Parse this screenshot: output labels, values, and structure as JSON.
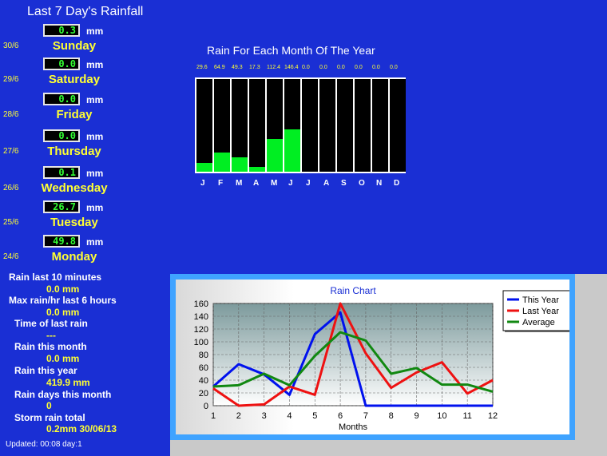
{
  "title": "Last 7 Day's Rainfall",
  "unit": "mm",
  "days": [
    {
      "date": "30/6",
      "name": "Sunday",
      "value": "0.3"
    },
    {
      "date": "29/6",
      "name": "Saturday",
      "value": "0.0"
    },
    {
      "date": "28/6",
      "name": "Friday",
      "value": "0.0"
    },
    {
      "date": "27/6",
      "name": "Thursday",
      "value": "0.0"
    },
    {
      "date": "26/6",
      "name": "Wednesday",
      "value": "0.1"
    },
    {
      "date": "25/6",
      "name": "Tuesday",
      "value": "26.7"
    },
    {
      "date": "24/6",
      "name": "Monday",
      "value": "49.8"
    }
  ],
  "stats": [
    {
      "label": "Rain last 10 minutes",
      "value": "0.0 mm"
    },
    {
      "label": "Max rain/hr last 6 hours",
      "value": "0.0 mm"
    },
    {
      "label": "Time of last rain",
      "value": "---"
    },
    {
      "label": "Rain this month",
      "value": "0.0 mm"
    },
    {
      "label": "Rain this year",
      "value": "419.9 mm"
    },
    {
      "label": "Rain days this month",
      "value": "0"
    },
    {
      "label": "Storm rain total",
      "value": "0.2mm 30/06/13"
    }
  ],
  "updated": "Updated: 00:08 day:1",
  "colors": {
    "background": "#1a2fd4",
    "highlight": "#ffff33",
    "bar": "#00ee22",
    "this_year": "#0011ee",
    "last_year": "#ee1111",
    "average": "#118811"
  },
  "chart_data": [
    {
      "type": "bar",
      "title": "Rain For Each Month Of The Year",
      "categories": [
        "J",
        "F",
        "M",
        "A",
        "M",
        "J",
        "J",
        "A",
        "S",
        "O",
        "N",
        "D"
      ],
      "values": [
        29.6,
        64.9,
        49.3,
        17.3,
        112.4,
        146.4,
        0.0,
        0.0,
        0.0,
        0.0,
        0.0,
        0.0
      ],
      "value_labels": [
        "29.6",
        "64.9",
        "49.3",
        "17.3",
        "112.4",
        "146.4",
        "0.0",
        "0.0",
        "0.0",
        "0.0",
        "0.0",
        "0.0"
      ],
      "ylim": [
        0,
        320
      ]
    },
    {
      "type": "line",
      "title": "Rain Chart",
      "xlabel": "Months",
      "ylabel": "",
      "x": [
        1,
        2,
        3,
        4,
        5,
        6,
        7,
        8,
        9,
        10,
        11,
        12
      ],
      "xlim": [
        1,
        12
      ],
      "ylim": [
        0,
        160
      ],
      "yticks": [
        0,
        20,
        40,
        60,
        80,
        100,
        120,
        140,
        160
      ],
      "grid": true,
      "legend": "top-right",
      "series": [
        {
          "name": "This Year",
          "color": "#0011ee",
          "values": [
            30,
            65,
            49,
            17,
            112,
            146,
            0,
            0,
            0,
            0,
            0,
            0
          ]
        },
        {
          "name": "Last Year",
          "color": "#ee1111",
          "values": [
            27,
            0,
            2,
            30,
            17,
            160,
            82,
            28,
            52,
            68,
            19,
            40
          ]
        },
        {
          "name": "Average",
          "color": "#118811",
          "values": [
            30,
            32,
            50,
            32,
            78,
            115,
            102,
            50,
            59,
            33,
            33,
            22
          ]
        }
      ]
    }
  ]
}
